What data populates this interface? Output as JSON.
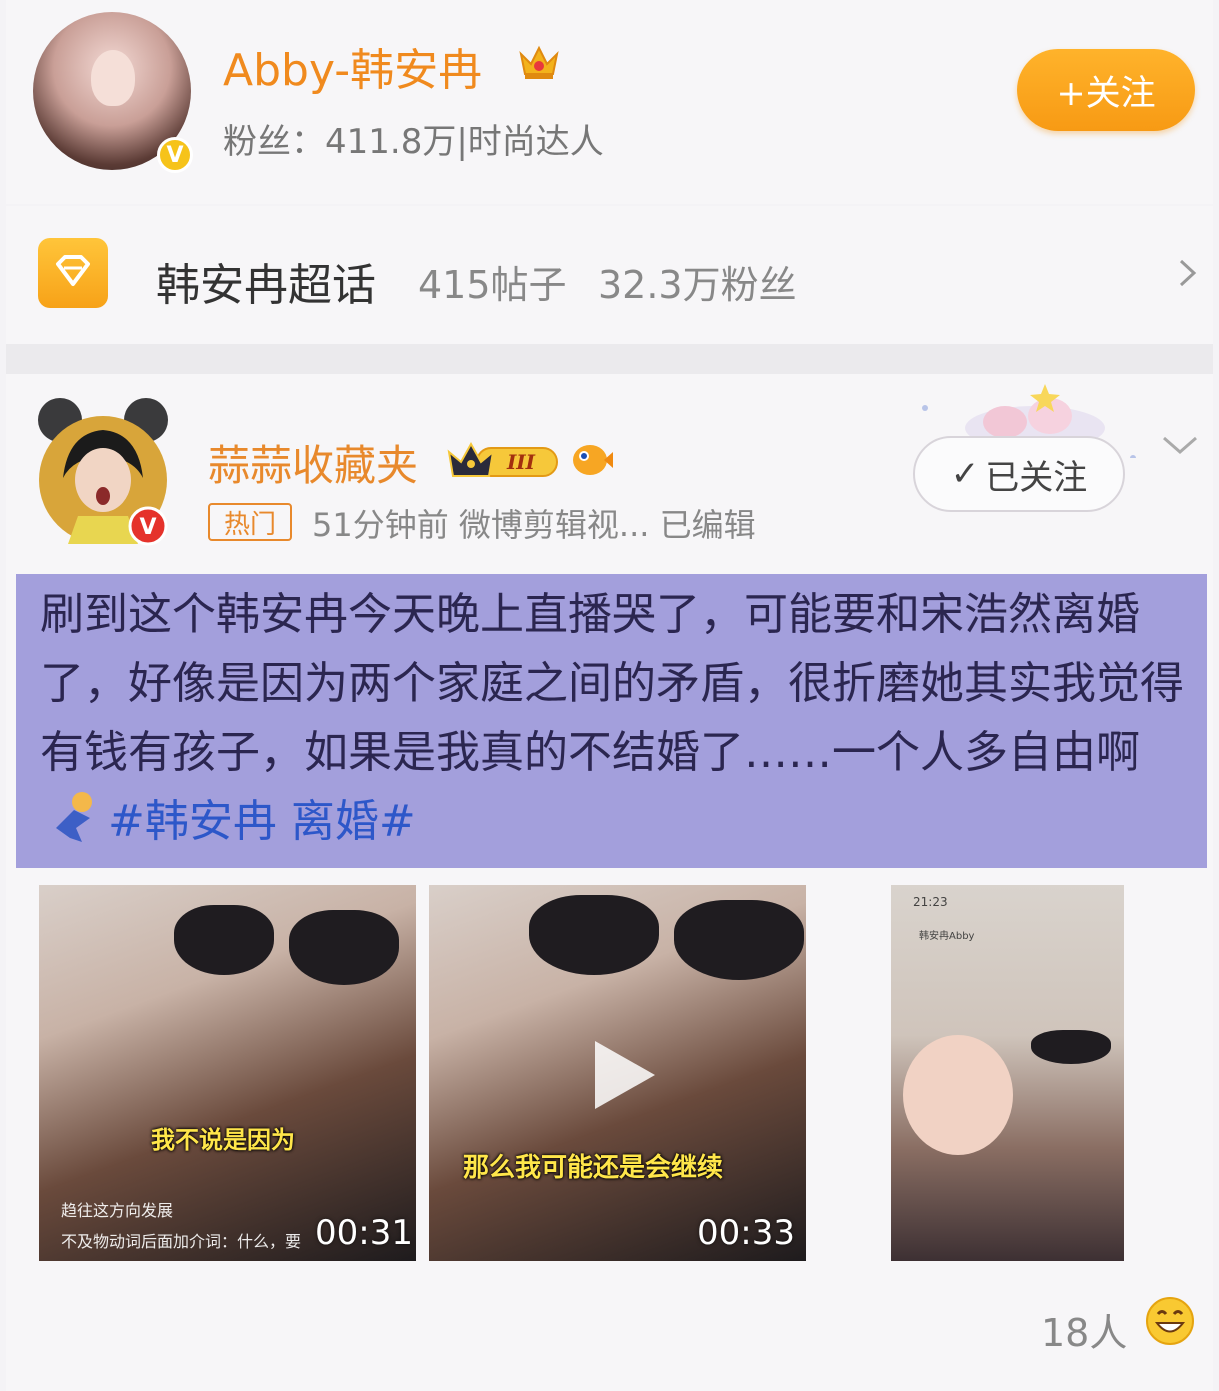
{
  "profile": {
    "name": "Abby-韩安冉",
    "stats": "粉丝：411.8万|时尚达人",
    "follow_label": "+关注"
  },
  "super_topic": {
    "title": "韩安冉超话",
    "posts": "415帖子",
    "fans": "32.3万粉丝"
  },
  "post": {
    "author": "蒜蒜收藏夹",
    "vip_level": "III",
    "hot_tag": "热门",
    "meta": "51分钟前  微博剪辑视...  已编辑",
    "followed_label": "已关注",
    "text": "刷到这个韩安冉今天晚上直播哭了，可能要和宋浩然离婚了，好像是因为两个家庭之间的矛盾，很折磨她其实我觉得有钱有孩子，如果是我真的不结婚了……一个人多自由啊",
    "hashtag": "#韩安冉 离婚#",
    "media": [
      {
        "subtitle": "我不说是因为",
        "duration": "00:31",
        "overlay_1": "趋往这方向发展",
        "overlay_2": "不及物动词后面加介词：什么，要"
      },
      {
        "subtitle": "那么我可能还是会继续",
        "duration": "00:33"
      },
      {
        "status_time": "21:23",
        "overlay_1": "韩安冉Abby"
      }
    ],
    "like_count": "18人"
  },
  "colors": {
    "accent_orange": "#f08a1e",
    "follow_btn": "#f79a14",
    "text_highlight_bg": "#a39fdc",
    "hashtag": "#2d57c9"
  }
}
